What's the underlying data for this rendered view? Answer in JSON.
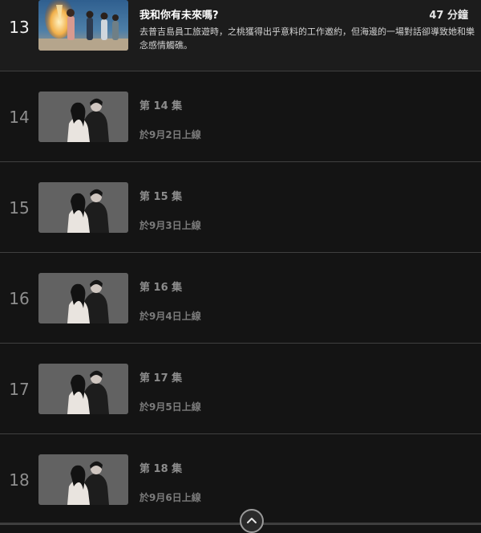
{
  "episodes": [
    {
      "number": "13",
      "title": "我和你有未來嗎?",
      "duration": "47 分鐘",
      "description": "去普吉島員工旅遊時，之桃獲得出乎意料的工作邀約，但海邊的一場對話卻導致她和樂念感情觸礁。",
      "thumbnail": "beach-party-night"
    },
    {
      "number": "14",
      "title": "第 14 集",
      "release": "於9月2日上線",
      "thumbnail": "couple-poster"
    },
    {
      "number": "15",
      "title": "第 15 集",
      "release": "於9月3日上線",
      "thumbnail": "couple-poster"
    },
    {
      "number": "16",
      "title": "第 16 集",
      "release": "於9月4日上線",
      "thumbnail": "couple-poster"
    },
    {
      "number": "17",
      "title": "第 17 集",
      "release": "於9月5日上線",
      "thumbnail": "couple-poster"
    },
    {
      "number": "18",
      "title": "第 18 集",
      "release": "於9月6日上線",
      "thumbnail": "couple-poster"
    }
  ],
  "controls": {
    "collapse_icon": "chevron-up-icon"
  }
}
